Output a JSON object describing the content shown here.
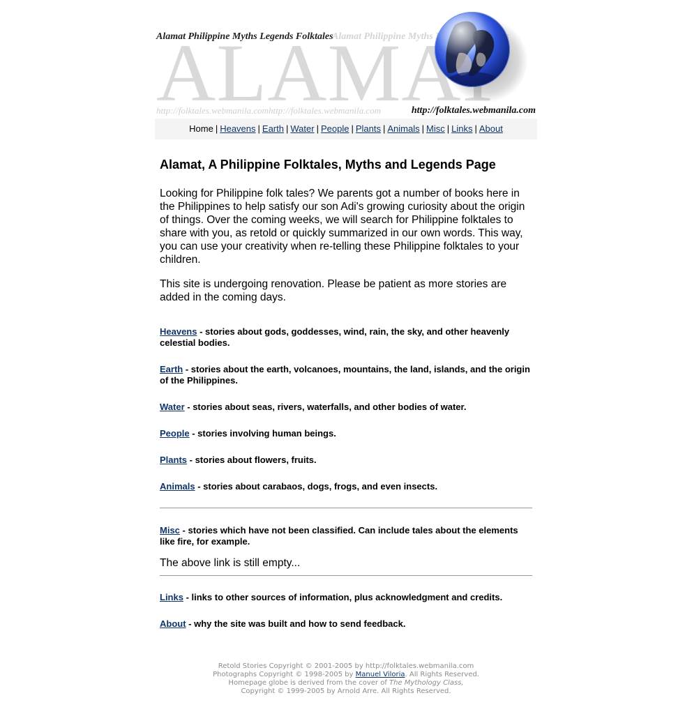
{
  "banner": {
    "big_text": "ALAMAT",
    "tagline": "Alamat Philippine Myths Legends Folktales",
    "tagline_ghost": "Alamat Philippine Myths Legends Folktales",
    "url_ghost": "http://folktales.webmanila.comhttp://folktales.webmanila.com",
    "url": "http://folktales.webmanila.com"
  },
  "nav": {
    "current": "Home",
    "links": [
      "Heavens",
      "Earth",
      "Water",
      "People",
      "Plants",
      "Animals",
      "Misc",
      "Links",
      "About"
    ]
  },
  "main": {
    "title": "Alamat, A Philippine Folktales, Myths and Legends Page",
    "intro": "Looking for Philippine folk tales? We parents got a number of books here in the Philippines to help satisfy our son Adi's growing curiosity about the origin of things. Over the coming weeks, we will search for Philippine folktales to share with you, as retold or quickly summarized in our own words. This way, you can use your creativity when re-telling these Philippine folktales to your children.",
    "renovation": "This site is undergoing renovation. Please be patient as more stories are added in the coming days.",
    "categories": [
      {
        "link": "Heavens",
        "desc": " - stories about gods, goddesses, wind, rain, the sky, and other heavenly celestial bodies."
      },
      {
        "link": "Earth",
        "desc": " - stories about the earth, volcanoes, mountains, the land, islands, and the origin of the Philippines."
      },
      {
        "link": "Water",
        "desc": " - stories about seas, rivers, waterfalls, and other bodies of water."
      },
      {
        "link": "People",
        "desc": " - stories involving human beings."
      },
      {
        "link": "Plants",
        "desc": " - stories about flowers, fruits."
      },
      {
        "link": "Animals",
        "desc": " - stories about carabaos, dogs, frogs, and even insects."
      }
    ],
    "misc": {
      "link": "Misc",
      "desc": " - stories which have not been classified. Can include tales about the elements like fire, for example."
    },
    "empty_note": "The above link is still empty...",
    "links_item": {
      "link": "Links",
      "desc": " - links to other sources of information, plus acknowledgment and credits."
    },
    "about_item": {
      "link": "About",
      "desc": " - why the site was built and how to send feedback."
    }
  },
  "footer": {
    "line1": "Retold Stories Copyright © 2001-2005 by http://folktales.webmanila.com",
    "line2_pre": "Photographs Copyright © 1998-2005 by ",
    "line2_link": "Manuel Viloria",
    "line2_post": ". All Rights Reserved.",
    "line3_pre": "Homepage globe is derived from the cover of ",
    "line3_italic": "The Mythology Class,",
    "line4": "Copyright © 1999-2005 by Arnold Arre. All Rights Reserved."
  },
  "colors": {
    "link": "#0e3569",
    "banner_ghost": "#d9d9d9",
    "nav_background": "#f4f4f4",
    "footer_text": "#8c8c8c",
    "globe_blue": "#2b4fd6"
  }
}
